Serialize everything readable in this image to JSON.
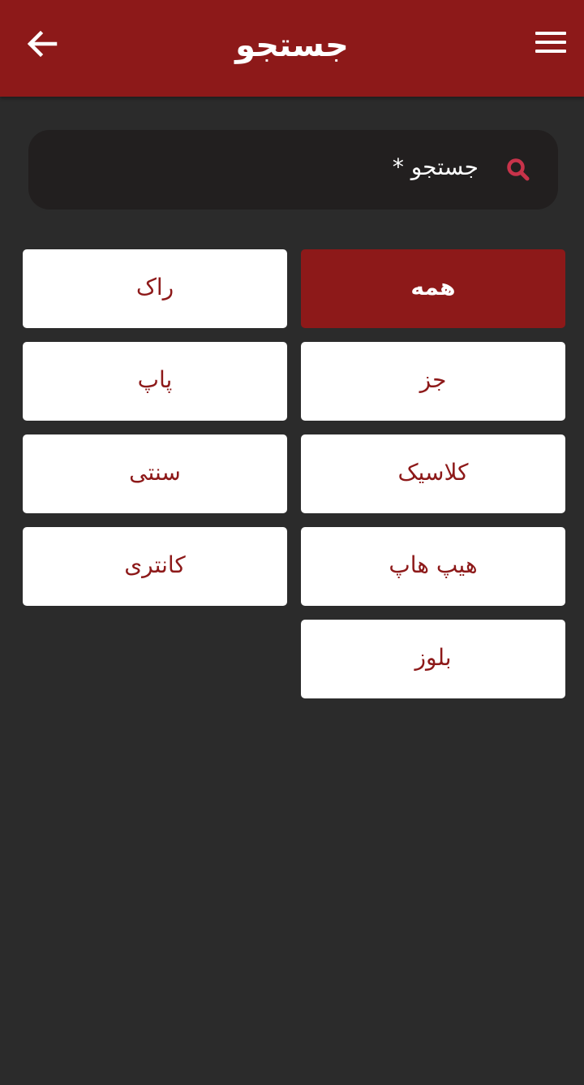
{
  "header": {
    "title": "جستجو",
    "back_icon": "arrow-left-icon",
    "menu_icon": "hamburger-menu-icon",
    "color": "#8d1919"
  },
  "search": {
    "placeholder": "جستجو *",
    "icon": "search-icon",
    "icon_color": "#c8334a"
  },
  "genres": [
    {
      "label": "همه",
      "selected": true
    },
    {
      "label": "راک",
      "selected": false
    },
    {
      "label": "جز",
      "selected": false
    },
    {
      "label": "پاپ",
      "selected": false
    },
    {
      "label": "کلاسیک",
      "selected": false
    },
    {
      "label": "سنتی",
      "selected": false
    },
    {
      "label": "هیپ هاپ",
      "selected": false
    },
    {
      "label": "کانتری",
      "selected": false
    },
    {
      "label": "بلوز",
      "selected": false
    }
  ],
  "colors": {
    "accent": "#8d1919",
    "background": "#2b2b2b",
    "search_bg": "#221f1f"
  }
}
